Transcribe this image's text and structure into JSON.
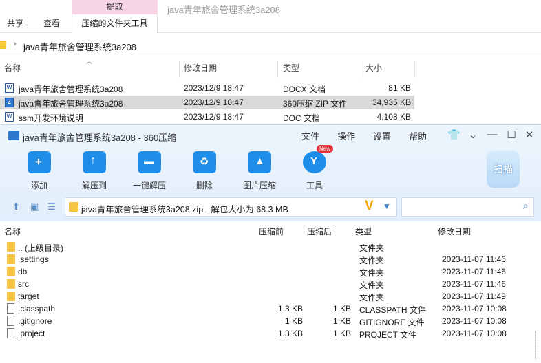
{
  "explorer": {
    "ribbon_context_header": "提取",
    "tabs": [
      "共享",
      "查看",
      "压缩的文件夹工具"
    ],
    "window_title": "java青年旅舍管理系统3a208",
    "address_path": "java青年旅舍管理系统3a208",
    "columns": [
      "名称",
      "修改日期",
      "类型",
      "大小"
    ],
    "files": [
      {
        "name": "java青年旅舍管理系统3a208",
        "date": "2023/12/9 18:47",
        "type": "DOCX 文档",
        "size": "81 KB",
        "icon": "word-doc-icon"
      },
      {
        "name": "java青年旅舍管理系统3a208",
        "date": "2023/12/9 18:47",
        "type": "360压缩 ZIP 文件",
        "size": "34,935 KB",
        "icon": "zip-archive-icon"
      },
      {
        "name": "ssm开发环境说明",
        "date": "2023/12/9 18:47",
        "type": "DOC 文档",
        "size": "4,108 KB",
        "icon": "word-doc-icon"
      }
    ]
  },
  "zip": {
    "title": "java青年旅舍管理系统3a208 - 360压缩",
    "menu": [
      "文件",
      "操作",
      "设置",
      "帮助"
    ],
    "tools": [
      "添加",
      "解压到",
      "一键解压",
      "删除",
      "图片压缩",
      "工具"
    ],
    "new_badge": "New",
    "scan_label": "扫描",
    "path_text": "java青年旅舍管理系统3a208.zip - 解包大小为 68.3 MB",
    "columns": [
      "名称",
      "压缩前",
      "压缩后",
      "类型",
      "修改日期"
    ],
    "rows": [
      {
        "name": ".. (上级目录)",
        "before": "",
        "after": "",
        "type": "文件夹",
        "date": "",
        "kind": "folder"
      },
      {
        "name": ".settings",
        "before": "",
        "after": "",
        "type": "文件夹",
        "date": "2023-11-07 11:46",
        "kind": "folder"
      },
      {
        "name": "db",
        "before": "",
        "after": "",
        "type": "文件夹",
        "date": "2023-11-07 11:46",
        "kind": "folder"
      },
      {
        "name": "src",
        "before": "",
        "after": "",
        "type": "文件夹",
        "date": "2023-11-07 11:46",
        "kind": "folder"
      },
      {
        "name": "target",
        "before": "",
        "after": "",
        "type": "文件夹",
        "date": "2023-11-07 11:49",
        "kind": "folder"
      },
      {
        "name": ".classpath",
        "before": "1.3 KB",
        "after": "1 KB",
        "type": "CLASSPATH 文件",
        "date": "2023-11-07 10:08",
        "kind": "file"
      },
      {
        "name": ".gitignore",
        "before": "1 KB",
        "after": "1 KB",
        "type": "GITIGNORE 文件",
        "date": "2023-11-07 10:08",
        "kind": "file"
      },
      {
        "name": ".project",
        "before": "1.3 KB",
        "after": "1 KB",
        "type": "PROJECT 文件",
        "date": "2023-11-07 10:08",
        "kind": "file"
      }
    ]
  }
}
